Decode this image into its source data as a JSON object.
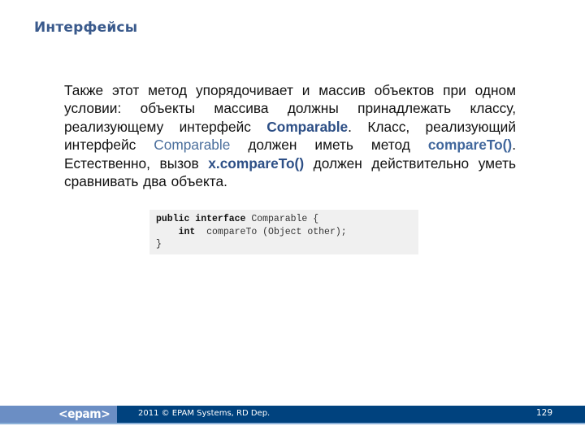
{
  "slide": {
    "title": "Интерфейсы",
    "paragraph": {
      "p1": "Также этот метод упорядочивает и массив объектов при одном условии: объекты массива должны принадлежать классу, реализующему интерфейс ",
      "h1": "Comparable",
      "p2": ". Класс, реализующий интерфейс ",
      "h2": "Comparable",
      "p3": " должен иметь метод ",
      "h3": "compareTo()",
      "p4": ". Естественно, вызов ",
      "h4": "x.compareTo()",
      "p5": " должен действительно уметь сравнивать два объекта."
    },
    "code": {
      "line1_kw": "public interface",
      "line1_rest": " Comparable {",
      "line2_indent": "    ",
      "line2_kw": "int",
      "line2_rest": "  compareTo (Object other);",
      "line3": "}"
    }
  },
  "footer": {
    "logo": "<epam>",
    "copyright": "2011 © EPAM Systems, RD Dep.",
    "page_number": "129"
  },
  "colors": {
    "title": "#3a5a8c",
    "footer_dark": "#00427e",
    "footer_light": "#6b8ec4",
    "code_bg": "#f0f0f0"
  }
}
